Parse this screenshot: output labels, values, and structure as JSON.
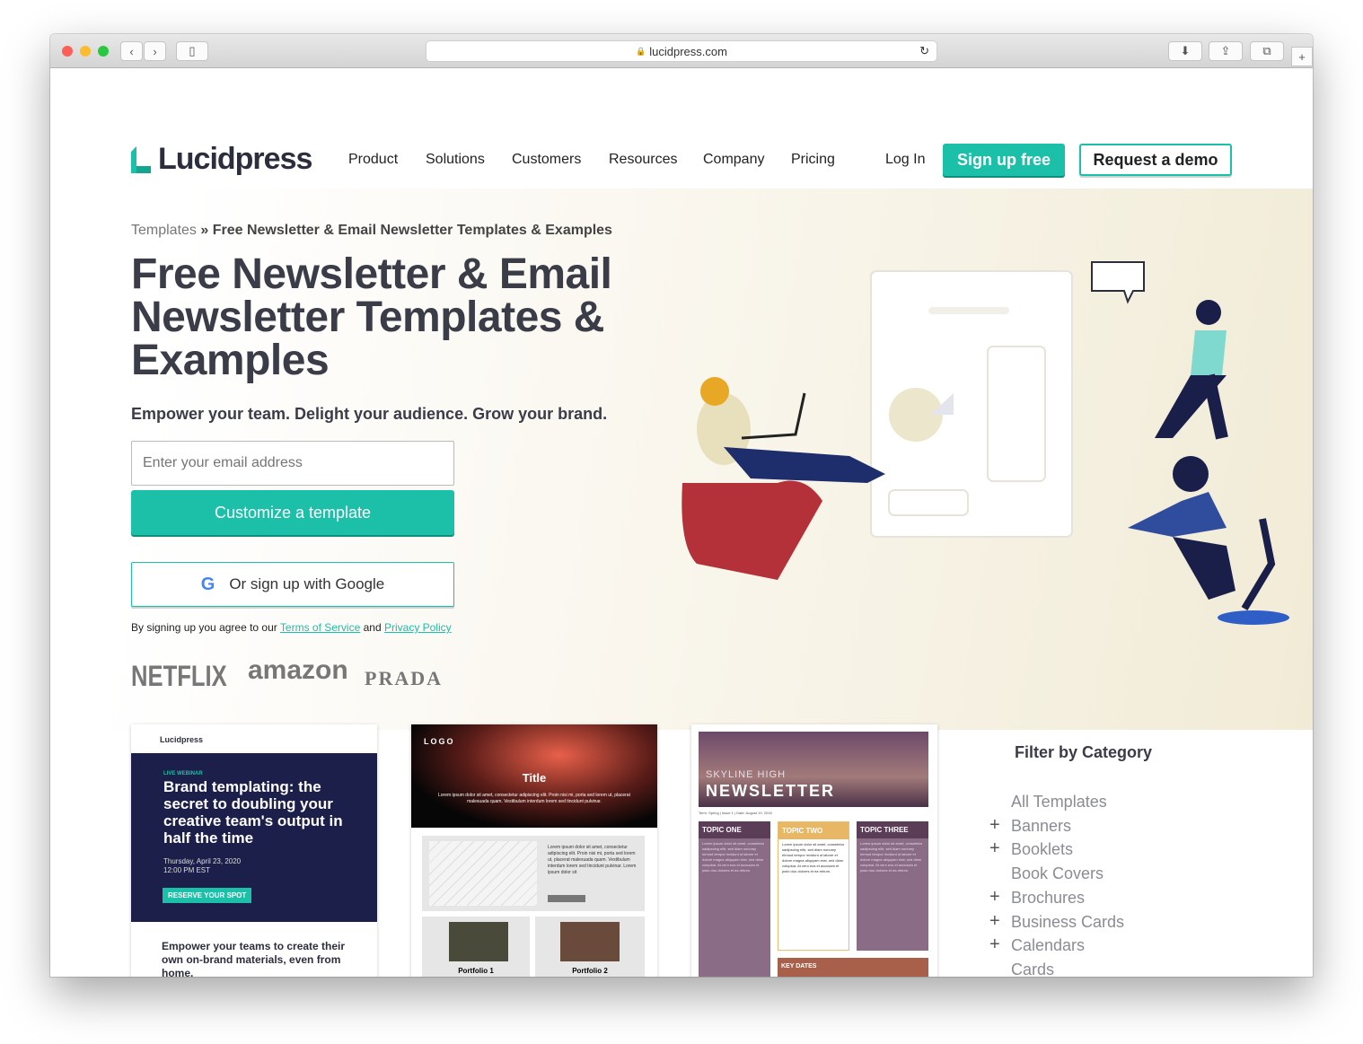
{
  "browser": {
    "url": "lucidpress.com"
  },
  "nav": {
    "logo": "Lucidpress",
    "items": [
      "Product",
      "Solutions",
      "Customers",
      "Resources",
      "Company",
      "Pricing"
    ],
    "login": "Log In",
    "signup": "Sign up free",
    "demo": "Request a demo"
  },
  "hero": {
    "breadcrumb_root": "Templates",
    "breadcrumb_sep": "»",
    "breadcrumb_current": "Free Newsletter & Email Newsletter Templates & Examples",
    "title": "Free Newsletter & Email Newsletter Templates & Examples",
    "subtitle": "Empower your team.  Delight your audience.  Grow your brand.",
    "email_placeholder": "Enter your email address",
    "customize": "Customize a template",
    "google": "Or sign up with Google",
    "terms_prefix": "By signing up you agree to our",
    "terms": "Terms of Service",
    "and": "and",
    "privacy": "Privacy Policy",
    "logos": [
      "NETFLIX",
      "amazon",
      "PRADA"
    ]
  },
  "cards": [
    {
      "brand": "Lucidpress",
      "tag": "LIVE WEBINAR",
      "title": "Brand templating: the secret to doubling your creative team's output in half the time",
      "date": "Thursday, April 23, 2020",
      "time": "12:00 PM EST",
      "cta": "RESERVE YOUR SPOT",
      "body": "Empower your teams to create their own on-brand materials, even from home."
    },
    {
      "logo": "LOGO",
      "title": "Title",
      "lorem": "Lorem ipsum dolor sit amet, consectetur adipiscing elit. Proin nisi mi, porta sed lorem ut, placerat malesuada quam. Vestibulum interdum lorem sed tincidunt pulvinar.",
      "lorem2": "Lorem ipsum dolor sit amet, consectetur adipiscing elit. Proin nisi mi, porta sed lorem ut, placerat malesuada quam. Vestibulum interdum lorem sed tincidunt pulvinar.  Lorem ipsum dolor sit",
      "p1": "Portfolio 1",
      "p2": "Portfolio 2"
    },
    {
      "school": "SKYLINE HIGH",
      "title": "NEWSLETTER",
      "meta": "Term: Spring | Issue 1 | Date: August 19, 2016",
      "topics": [
        "TOPIC ONE",
        "TOPIC TWO",
        "TOPIC THREE"
      ],
      "key": "KEY DATES",
      "lorem": "Lorem ipsum dolor sit amet, consetetur sadipscing elitr, sed diam nonumy eirmod tempor invidunt ut labore et dolore magna aliquyam erat, sed diam voluptua. At vero eos et accusam et justo duo dolores et ea rebum."
    }
  ],
  "filter": {
    "title": "Filter by Category",
    "items": [
      {
        "label": "All Templates",
        "expandable": false
      },
      {
        "label": "Banners",
        "expandable": true
      },
      {
        "label": "Booklets",
        "expandable": true
      },
      {
        "label": "Book Covers",
        "expandable": false
      },
      {
        "label": "Brochures",
        "expandable": true
      },
      {
        "label": "Business Cards",
        "expandable": true
      },
      {
        "label": "Calendars",
        "expandable": true
      },
      {
        "label": "Cards",
        "expandable": false
      }
    ]
  },
  "colors": {
    "accent": "#1cbfa8",
    "navy": "#1c1f4a",
    "heading": "#3a3c48"
  }
}
